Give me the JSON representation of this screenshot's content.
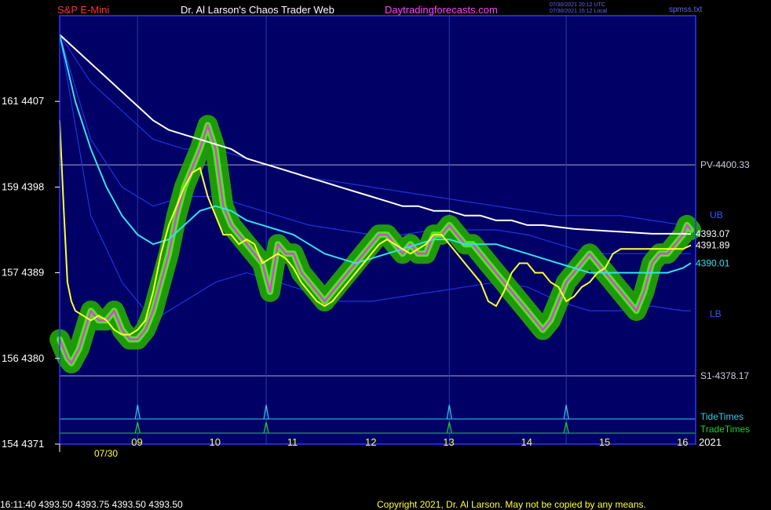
{
  "header": {
    "symbol": "S&P E-Mini",
    "title": "Dr. Al Larson's Chaos Trader Web",
    "site": "Daytradingforecasts.com",
    "utc_time": "07/30/2021 20:12 UTC",
    "local_time": "07/30/2021 15:12 Local",
    "file": "spmss.txt"
  },
  "footer": {
    "quote": "16:11:40  4393.50 4393.75 4393.50 4393.50",
    "copyright": "Copyright 2021, Dr. Al Larson. May not be copied by any means."
  },
  "colors": {
    "background": "#000066",
    "frame": "#3333ff",
    "price": "#e040e0",
    "halo": "#22aa00",
    "fast_ma": "#ffff33",
    "mid_ma": "#33e0f0",
    "slow_ma": "#ffffff",
    "band": "#2233dd",
    "tide": "#33ccee",
    "trade": "#22cc33"
  },
  "chart_data": {
    "type": "line",
    "date_label": "07/30",
    "year_label": "2021",
    "xlim": [
      8.0,
      16.1
    ],
    "ylim": [
      4371,
      4416
    ],
    "x_ticks": [
      {
        "label": "09",
        "x": 9
      },
      {
        "label": "10",
        "x": 10
      },
      {
        "label": "11",
        "x": 11
      },
      {
        "label": "12",
        "x": 12
      },
      {
        "label": "13",
        "x": 13
      },
      {
        "label": "14",
        "x": 14
      },
      {
        "label": "15",
        "x": 15
      },
      {
        "label": "16",
        "x": 16
      }
    ],
    "y_ticks": [
      {
        "label": "161  4407",
        "y": 4407
      },
      {
        "label": "159  4398",
        "y": 4398
      },
      {
        "label": "157  4389",
        "y": 4389
      },
      {
        "label": "156  4380",
        "y": 4380
      },
      {
        "label": "154  4371",
        "y": 4371
      }
    ],
    "levels": [
      {
        "label": "PV-4400.33",
        "y": 4400.33
      },
      {
        "label": "S1-4378.17",
        "y": 4378.17
      }
    ],
    "time_lines": [
      9.0,
      10.65,
      13.0,
      14.5
    ],
    "tide_label": "TideTimes",
    "trade_label": "TradeTimes",
    "band_labels": {
      "upper": "UB",
      "lower": "LB"
    },
    "value_labels": [
      {
        "label": "4393.07",
        "y": 4393.07,
        "color": "#ffffff"
      },
      {
        "label": "4391.89",
        "y": 4391.89,
        "color": "#ffffff"
      },
      {
        "label": "4390.01",
        "y": 4390.01,
        "color": "#33e0f0"
      }
    ],
    "series": [
      {
        "key": "price",
        "x": [
          8.0,
          8.1,
          8.15,
          8.25,
          8.4,
          8.5,
          8.6,
          8.7,
          8.8,
          8.9,
          9.0,
          9.1,
          9.2,
          9.3,
          9.4,
          9.5,
          9.6,
          9.7,
          9.8,
          9.9,
          10.0,
          10.1,
          10.2,
          10.3,
          10.4,
          10.5,
          10.6,
          10.7,
          10.8,
          10.9,
          11.0,
          11.1,
          11.2,
          11.3,
          11.4,
          11.5,
          11.6,
          11.7,
          11.8,
          11.9,
          12.0,
          12.1,
          12.2,
          12.3,
          12.4,
          12.5,
          12.6,
          12.7,
          12.8,
          12.9,
          13.0,
          13.1,
          13.2,
          13.3,
          13.4,
          13.5,
          13.6,
          13.7,
          13.8,
          13.9,
          14.0,
          14.1,
          14.2,
          14.3,
          14.4,
          14.5,
          14.6,
          14.7,
          14.8,
          14.9,
          15.0,
          15.1,
          15.2,
          15.3,
          15.4,
          15.5,
          15.6,
          15.7,
          15.8,
          15.9,
          16.0,
          16.05,
          16.1
        ],
        "y": [
          4382,
          4380,
          4379.5,
          4381,
          4385,
          4384,
          4384,
          4385,
          4383,
          4382,
          4382,
          4383,
          4385,
          4388,
          4391,
          4395,
          4398,
          4400,
          4402,
          4404.5,
          4402,
          4396,
          4394,
          4393,
          4392,
          4391,
          4390,
          4387,
          4392,
          4391,
          4391,
          4389,
          4388,
          4387,
          4386,
          4387,
          4388,
          4389,
          4390,
          4391,
          4392,
          4393,
          4393,
          4392,
          4391,
          4392,
          4391,
          4391,
          4393,
          4393,
          4394,
          4393,
          4392,
          4392,
          4391,
          4390,
          4389,
          4388,
          4387,
          4386,
          4385,
          4384,
          4383,
          4384,
          4386,
          4388,
          4389,
          4390,
          4391,
          4390,
          4389,
          4388,
          4387,
          4386,
          4385,
          4387,
          4390,
          4391,
          4391,
          4392,
          4393,
          4394,
          4393.5
        ]
      },
      {
        "key": "fast_ma",
        "x": [
          8.0,
          8.05,
          8.1,
          8.15,
          8.2,
          8.3,
          8.4,
          8.5,
          8.6,
          8.7,
          8.8,
          8.9,
          9.0,
          9.1,
          9.2,
          9.3,
          9.4,
          9.5,
          9.6,
          9.7,
          9.8,
          9.9,
          10.0,
          10.1,
          10.2,
          10.3,
          10.4,
          10.5,
          10.6,
          10.7,
          10.8,
          10.9,
          11.0,
          11.1,
          11.2,
          11.3,
          11.4,
          11.5,
          11.6,
          11.7,
          11.8,
          11.9,
          12.0,
          12.1,
          12.2,
          12.3,
          12.4,
          12.5,
          12.6,
          12.7,
          12.8,
          12.9,
          13.0,
          13.1,
          13.2,
          13.3,
          13.4,
          13.5,
          13.6,
          13.7,
          13.8,
          13.9,
          14.0,
          14.1,
          14.2,
          14.3,
          14.4,
          14.5,
          14.6,
          14.7,
          14.8,
          14.9,
          15.0,
          15.1,
          15.2,
          15.3,
          15.4,
          15.5,
          15.6,
          15.7,
          15.8,
          15.9,
          16.0,
          16.1
        ],
        "y": [
          4405,
          4396,
          4388,
          4386,
          4385,
          4384.5,
          4384,
          4384.5,
          4384,
          4383,
          4382.5,
          4382.5,
          4383,
          4384,
          4387,
          4391,
          4394,
          4396,
          4398,
          4399.5,
          4400,
          4397,
          4395,
          4393,
          4393,
          4392,
          4392.5,
          4392,
          4390,
          4390.5,
          4391,
          4390.5,
          4389.5,
          4388,
          4387,
          4386,
          4385.5,
          4386,
          4387,
          4388,
          4389,
          4390,
          4391,
          4392,
          4392.5,
          4392,
          4391.5,
          4391,
          4391.5,
          4392,
          4393,
          4393,
          4392,
          4391,
          4390,
          4389,
          4388,
          4386,
          4385.5,
          4387,
          4389,
          4390,
          4390,
          4389,
          4389,
          4388,
          4387.5,
          4386,
          4386.5,
          4387.5,
          4388,
          4389,
          4389.5,
          4391,
          4391.5,
          4391.5,
          4391.5,
          4391.5,
          4391.5,
          4391.5,
          4391.5,
          4391.5,
          4391.5,
          4391.89
        ]
      },
      {
        "key": "mid_ma",
        "x": [
          8.0,
          8.2,
          8.4,
          8.6,
          8.8,
          9.0,
          9.2,
          9.4,
          9.6,
          9.8,
          10.0,
          10.2,
          10.4,
          10.6,
          10.8,
          11.0,
          11.2,
          11.4,
          11.6,
          11.8,
          12.0,
          12.2,
          12.4,
          12.6,
          12.8,
          13.0,
          13.2,
          13.4,
          13.6,
          13.8,
          14.0,
          14.2,
          14.4,
          14.6,
          14.8,
          15.0,
          15.2,
          15.4,
          15.6,
          15.8,
          16.0,
          16.1
        ],
        "y": [
          4414,
          4407,
          4402,
          4398,
          4395,
          4393,
          4392,
          4392.5,
          4394,
          4395.5,
          4396,
          4395.5,
          4394.5,
          4394,
          4393.5,
          4393,
          4392,
          4391,
          4390.5,
          4390,
          4390.5,
          4391,
          4391.5,
          4392,
          4392.5,
          4392.5,
          4392,
          4392,
          4392,
          4391.5,
          4391,
          4390.5,
          4390,
          4389.5,
          4389,
          4389,
          4389,
          4389,
          4389,
          4389,
          4389.5,
          4390.01
        ]
      },
      {
        "key": "slow_ma",
        "x": [
          8.0,
          8.2,
          8.4,
          8.6,
          8.8,
          9.0,
          9.2,
          9.4,
          9.6,
          9.8,
          10.0,
          10.2,
          10.4,
          10.6,
          10.8,
          11.0,
          11.2,
          11.4,
          11.6,
          11.8,
          12.0,
          12.2,
          12.4,
          12.6,
          12.8,
          13.0,
          13.2,
          13.4,
          13.6,
          13.8,
          14.0,
          14.2,
          14.4,
          14.6,
          14.8,
          15.0,
          15.2,
          15.4,
          15.6,
          15.8,
          16.0,
          16.1
        ],
        "y": [
          4414,
          4412.5,
          4411,
          4409.5,
          4408,
          4406.5,
          4405,
          4404,
          4403.5,
          4403,
          4402.5,
          4402,
          4401,
          4400.5,
          4400,
          4399.5,
          4399,
          4398.5,
          4398,
          4397.5,
          4397,
          4396.5,
          4396,
          4396,
          4395.5,
          4395.5,
          4395,
          4395,
          4394.5,
          4394.5,
          4394,
          4394,
          4393.8,
          4393.6,
          4393.5,
          4393.4,
          4393.3,
          4393.2,
          4393.1,
          4393.1,
          4393.1,
          4393.07
        ]
      },
      {
        "key": "band_upper",
        "x": [
          8.0,
          8.4,
          8.8,
          9.2,
          9.6,
          10.0,
          10.4,
          10.8,
          11.2,
          11.6,
          12.0,
          12.4,
          12.8,
          13.2,
          13.6,
          14.0,
          14.4,
          14.8,
          15.2,
          15.6,
          16.0,
          16.1
        ],
        "y": [
          4414,
          4409,
          4406,
          4403,
          4402,
          4402,
          4401,
          4400,
          4399,
          4398.5,
          4398,
          4397.5,
          4397,
          4396.5,
          4396,
          4395.5,
          4395,
          4395,
          4395,
          4394.5,
          4394,
          4394
        ]
      },
      {
        "key": "band_lower",
        "x": [
          8.0,
          8.4,
          8.8,
          9.2,
          9.6,
          10.0,
          10.4,
          10.8,
          11.2,
          11.6,
          12.0,
          12.4,
          12.8,
          13.2,
          13.6,
          14.0,
          14.4,
          14.8,
          15.2,
          15.6,
          16.0,
          16.1
        ],
        "y": [
          4414,
          4395,
          4388,
          4384,
          4386,
          4388,
          4389,
          4388,
          4387,
          4386,
          4386,
          4386.5,
          4387,
          4387.5,
          4388,
          4387.5,
          4386,
          4385,
          4385,
          4385.5,
          4385,
          4385
        ]
      },
      {
        "key": "band_mid",
        "x": [
          8.0,
          8.4,
          8.8,
          9.2,
          9.6,
          10.0,
          10.4,
          10.8,
          11.2,
          11.6,
          12.0,
          12.4,
          12.8,
          13.2,
          13.6,
          14.0,
          14.4,
          14.8,
          15.2,
          15.6,
          16.0,
          16.1
        ],
        "y": [
          4414,
          4403,
          4398,
          4396,
          4397,
          4397,
          4396,
          4395,
          4394,
          4393.5,
          4393,
          4393,
          4393.5,
          4393.5,
          4393.5,
          4393,
          4392,
          4391,
          4391,
          4391,
          4391,
          4391
        ]
      }
    ]
  }
}
